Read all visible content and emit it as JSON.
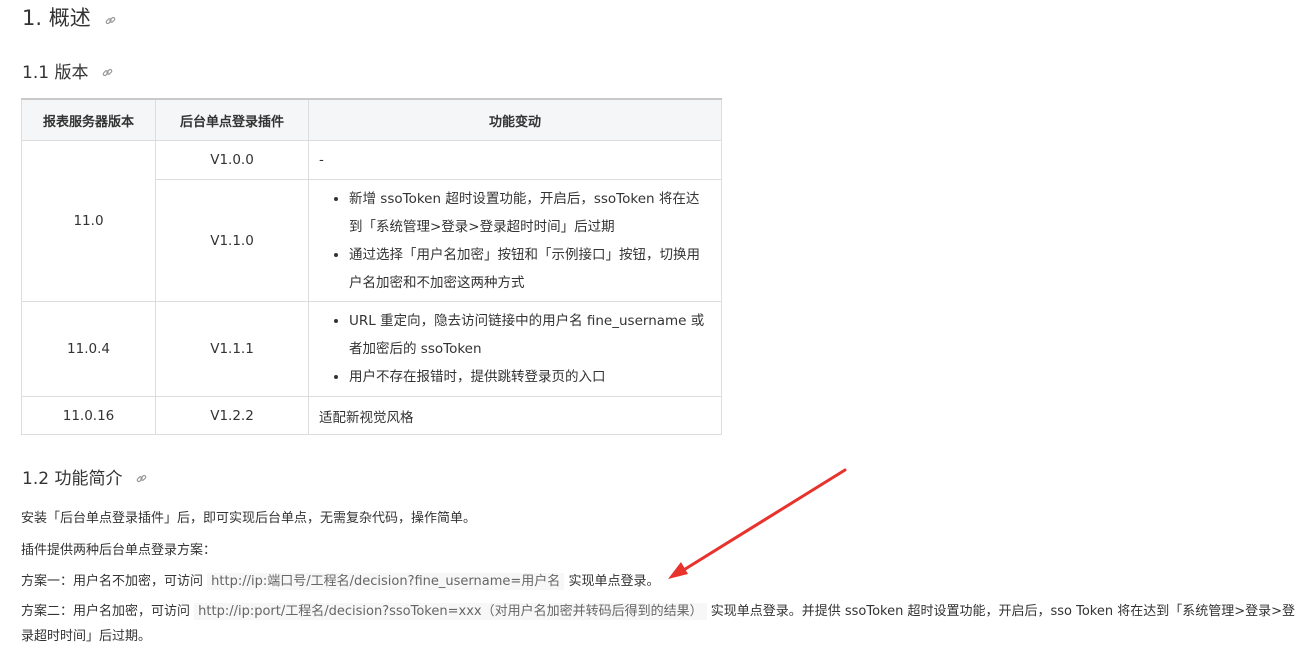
{
  "heading1": "1. 概述",
  "heading_version": "1.1 版本",
  "heading_intro": "1.2 功能简介",
  "table": {
    "headers": [
      "报表服务器版本",
      "后台单点登录插件",
      "功能变动"
    ],
    "rows": [
      {
        "server": "11.0",
        "plugin": "V1.0.0",
        "change": "-"
      },
      {
        "plugin": "V1.1.0",
        "changes": [
          "新增 ssoToken 超时设置功能，开启后，ssoToken 将在达到「系统管理>登录>登录超时时间」后过期",
          "通过选择「用户名加密」按钮和「示例接口」按钮，切换用户名加密和不加密这两种方式"
        ]
      },
      {
        "server": "11.0.4",
        "plugin": "V1.1.1",
        "changes": [
          "URL 重定向，隐去访问链接中的用户名 fine_username 或者加密后的 ssoToken",
          "用户不存在报错时，提供跳转登录页的入口"
        ]
      },
      {
        "server": "11.0.16",
        "plugin": "V1.2.2",
        "change": "适配新视觉风格"
      }
    ]
  },
  "intro": {
    "p1": "安装「后台单点登录插件」后，即可实现后台单点，无需复杂代码，操作简单。",
    "p2": "插件提供两种后台单点登录方案：",
    "p3_prefix": "方案一：用户名不加密，可访问",
    "p3_code": "http://ip:端口号/工程名/decision?fine_username=用户名",
    "p3_suffix": "实现单点登录。",
    "p4_prefix": "方案二：用户名加密，可访问",
    "p4_code": "http://ip:port/工程名/decision?ssoToken=xxx（对用户名加密并转码后得到的结果）",
    "p4_suffix": "实现单点登录。并提供 ssoToken 超时设置功能，开启后，sso Token 将在达到「系统管理>登录>登录超时时间」后过期。"
  },
  "colors": {
    "arrow": "#e8322c",
    "link_icon": "#999999",
    "table_header_bg": "#f5f6f7"
  },
  "icons": {
    "heading_link": "link-icon"
  }
}
